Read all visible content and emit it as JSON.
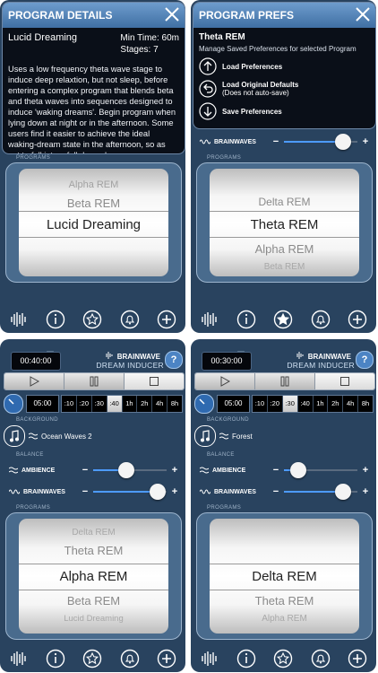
{
  "colors": {
    "panel": "#29435f",
    "accent": "#4d9bff",
    "header": "#5a8bc0"
  },
  "program_details": {
    "title": "PROGRAM DETAILS",
    "program": "Lucid Dreaming",
    "min_time": "Min Time: 60m",
    "stages": "Stages: 7",
    "description": "Uses a low frequency theta wave stage to induce deep relaxtion, but not sleep, before entering a complex program that blends beta and theta waves into sequences designed to induce 'waking dreams'. Begin program when lying down at night or in the afternoon. Some users find it easier to achieve the ideal waking-dream state in the afternoon, so as not to fall into a full deep sleep."
  },
  "program_prefs": {
    "title": "PROGRAM PREFS",
    "program": "Theta REM",
    "subtitle": "Manage Saved Preferences for selected Program",
    "load_prefs": "Load Preferences",
    "load_defaults": "Load Original Defaults",
    "load_defaults_note": "(Does not auto-save)",
    "save_prefs": "Save Preferences"
  },
  "labels": {
    "brainwaves": "BRAINWAVES",
    "ambience": "AMBIENCE",
    "programs": "PROGRAMS",
    "background": "BACKGROUND",
    "balance": "BALANCE",
    "minus": "−",
    "plus": "+",
    "brand": "BRAINWAVE",
    "brand_sub": "DREAM INDUCER",
    "help": "?"
  },
  "panels": {
    "p1": {
      "wheel": [
        "Alpha REM",
        "Beta REM",
        "Lucid Dreaming"
      ],
      "brainwaves_level": 0.8
    },
    "p2": {
      "wheel": [
        "Delta REM",
        "Theta REM",
        "Alpha REM",
        "Beta REM"
      ],
      "brainwaves_level": 0.8
    },
    "p3": {
      "timer": "00:40:00",
      "time_current": "05:00",
      "durations": [
        ":10",
        ":20",
        ":30",
        ":40",
        "1h",
        "2h",
        "4h",
        "8h"
      ],
      "selected_duration": ":40",
      "background": "Ocean Waves 2",
      "ambience_level": 0.45,
      "brainwaves_level": 0.88,
      "wheel": [
        "Delta REM",
        "Theta REM",
        "Alpha REM",
        "Beta REM",
        "Lucid Dreaming"
      ]
    },
    "p4": {
      "timer": "00:30:00",
      "time_current": "05:00",
      "durations": [
        ":10",
        ":20",
        ":30",
        ":40",
        "1h",
        "2h",
        "4h",
        "8h"
      ],
      "selected_duration": ":30",
      "background": "Forest",
      "ambience_level": 0.2,
      "brainwaves_level": 0.8,
      "wheel": [
        "Delta REM",
        "Theta REM",
        "Alpha REM"
      ]
    }
  },
  "icons": [
    "close-icon",
    "waveform-icon",
    "info-icon",
    "star-icon",
    "bell-icon",
    "plus-icon",
    "play-icon",
    "pause-icon",
    "stop-icon",
    "music-note-icon",
    "arrow-up-icon",
    "arrow-undo-icon",
    "arrow-down-icon",
    "timer-dial-icon"
  ]
}
